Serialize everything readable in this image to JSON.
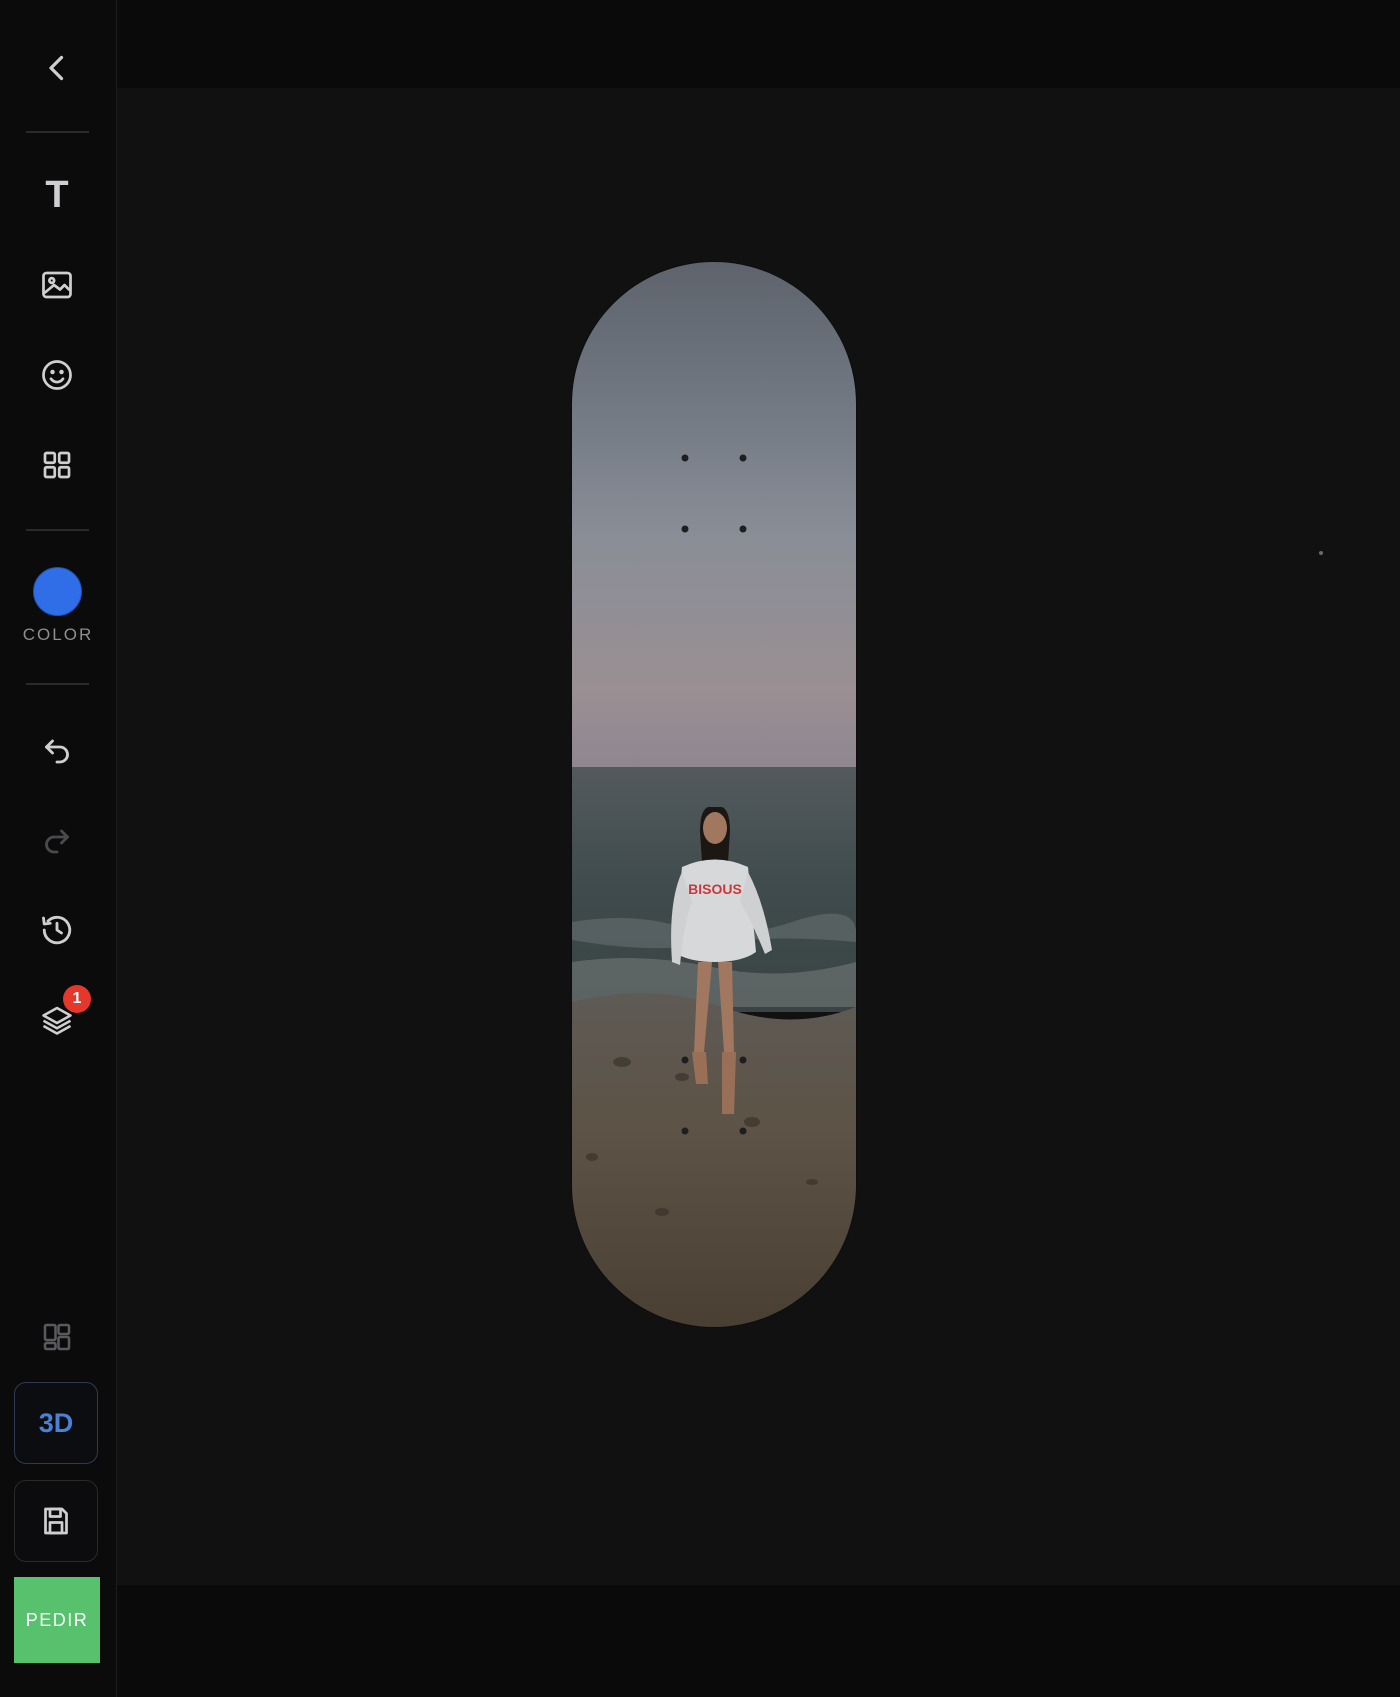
{
  "sidebar": {
    "tools": {
      "text_tool_glyph": "T",
      "color_label": "COLOR",
      "layers_badge": "1"
    },
    "buttons": {
      "view_3d_label": "3D",
      "order_label": "PEDIR"
    }
  },
  "deck": {
    "print_text": "BISOUS"
  },
  "colors": {
    "selected_color": "#2f6ee6",
    "order_button": "#57c16d",
    "badge": "#e5372b",
    "accent_3d": "#4a80d6"
  },
  "icons": [
    "back-icon",
    "text-icon",
    "image-icon",
    "emoji-icon",
    "templates-icon",
    "undo-icon",
    "redo-icon",
    "history-icon",
    "layers-icon",
    "layout-icon",
    "save-icon"
  ]
}
